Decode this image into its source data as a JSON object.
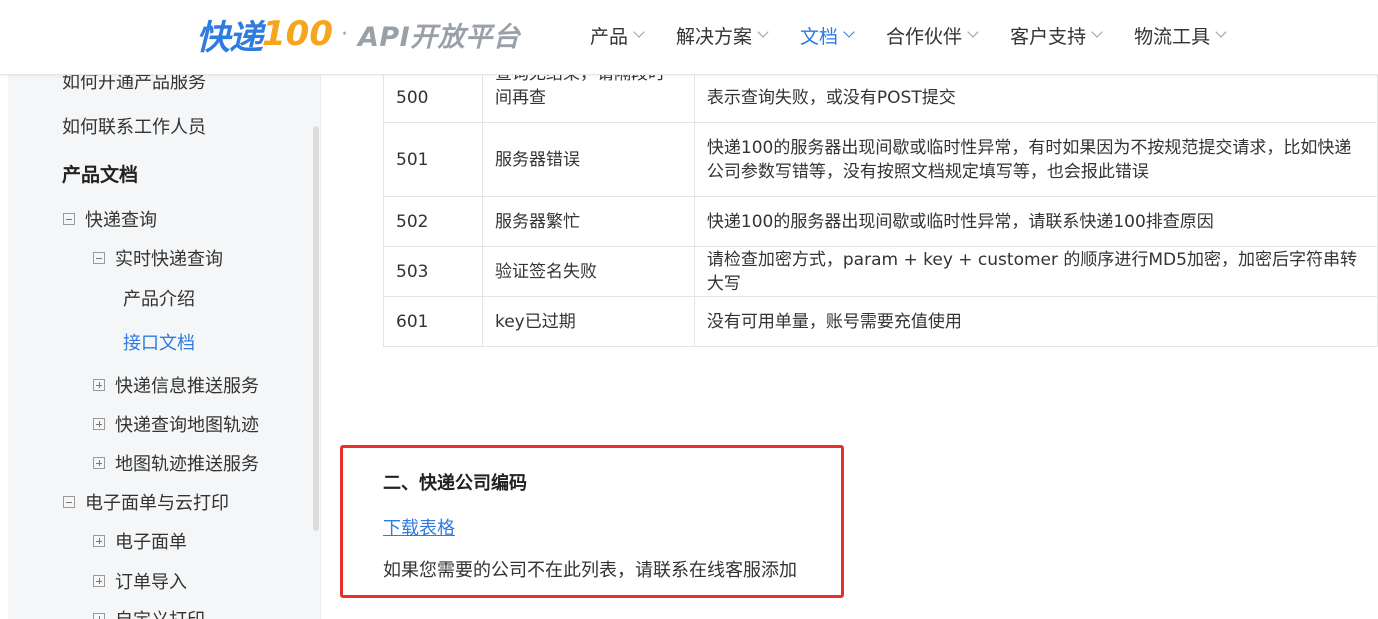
{
  "logo": {
    "brand": "快递",
    "brand_num": "100",
    "dot": "·",
    "subtitle": "API开放平台"
  },
  "nav": {
    "items": [
      {
        "label": "产品"
      },
      {
        "label": "解决方案"
      },
      {
        "label": "文档",
        "active": true
      },
      {
        "label": "合作伙伴"
      },
      {
        "label": "客户支持"
      },
      {
        "label": "物流工具"
      }
    ]
  },
  "sidebar": {
    "items": [
      {
        "label": "如何开通产品服务"
      },
      {
        "label": "如何联系工作人员"
      },
      {
        "label": "产品文档"
      },
      {
        "label": "快递查询"
      },
      {
        "label": "实时快递查询"
      },
      {
        "label": "产品介绍"
      },
      {
        "label": "接口文档"
      },
      {
        "label": "快递信息推送服务"
      },
      {
        "label": "快递查询地图轨迹"
      },
      {
        "label": "地图轨迹推送服务"
      },
      {
        "label": "电子面单与云打印"
      },
      {
        "label": "电子面单"
      },
      {
        "label": "订单导入"
      },
      {
        "label": "自定义打印"
      }
    ]
  },
  "error_table": {
    "rows": [
      {
        "code": "500",
        "name": "查询无结果，请隔段时间再查",
        "desc": "表示查询失败，或没有POST提交"
      },
      {
        "code": "501",
        "name": "服务器错误",
        "desc": "快递100的服务器出现间歇或临时性异常，有时如果因为不按规范提交请求，比如快递公司参数写错等，没有按照文档规定填写等，也会报此错误"
      },
      {
        "code": "502",
        "name": "服务器繁忙",
        "desc": "快递100的服务器出现间歇或临时性异常，请联系快递100排查原因"
      },
      {
        "code": "503",
        "name": "验证签名失败",
        "desc": "请检查加密方式，param + key + customer 的顺序进行MD5加密，加密后字符串转大写"
      },
      {
        "code": "601",
        "name": "key已过期",
        "desc": "没有可用单量，账号需要充值使用"
      }
    ]
  },
  "section": {
    "title": "二、快递公司编码",
    "download_link": "下载表格",
    "note": "如果您需要的公司不在此列表，请联系在线客服添加"
  },
  "colors": {
    "accent": "#2f7be0",
    "highlight_border": "#e8302a",
    "logo_orange": "#f7a51d"
  }
}
